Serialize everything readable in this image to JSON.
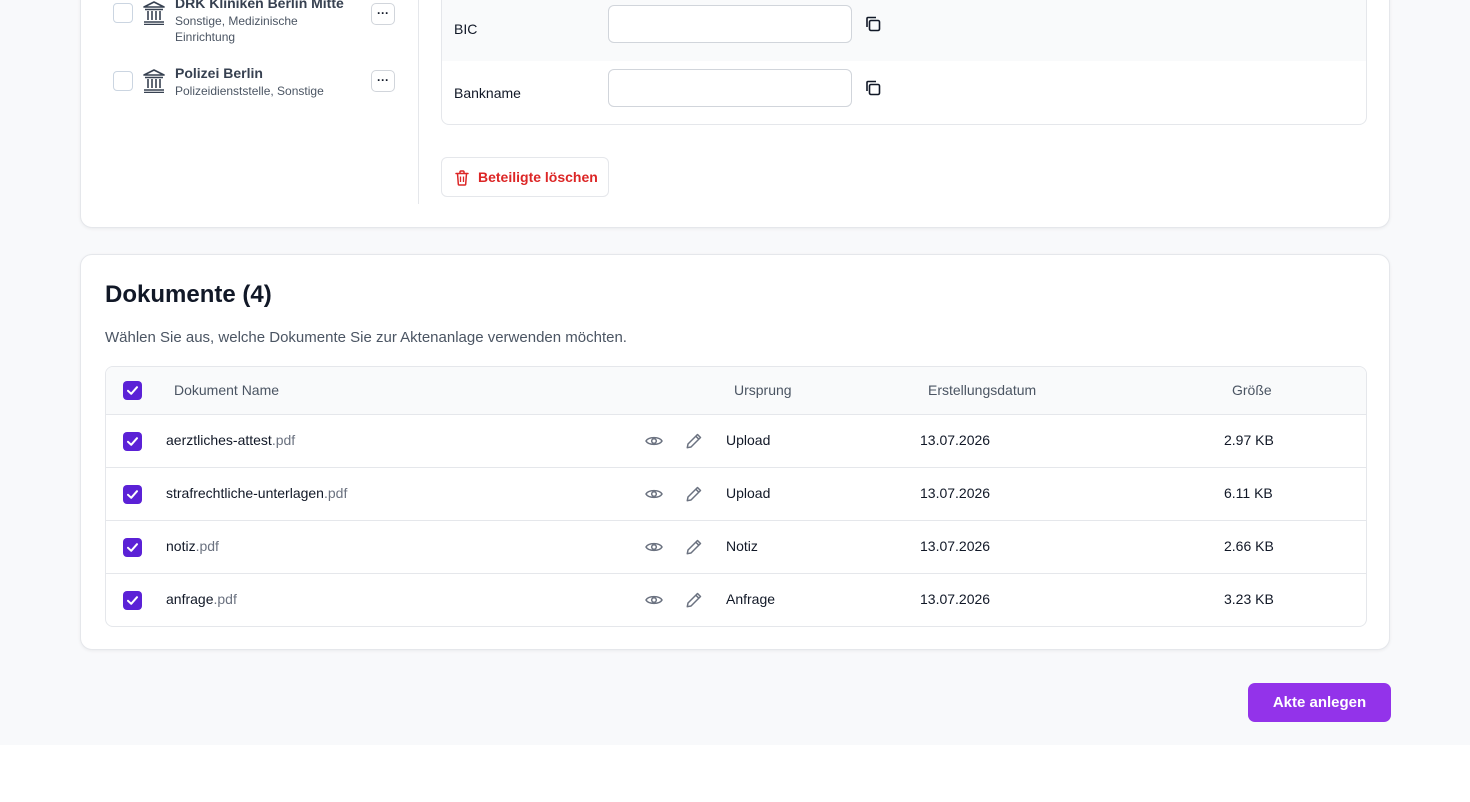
{
  "parties": [
    {
      "name": "DRK Kliniken Berlin Mitte",
      "subtitle": "Sonstige, Medizinische Einrichtung",
      "more_label": "···"
    },
    {
      "name": "Polizei Berlin",
      "subtitle": "Polizeidienststelle, Sonstige",
      "more_label": "···"
    }
  ],
  "bank_fields": {
    "bic": {
      "label": "BIC",
      "value": ""
    },
    "bankname": {
      "label": "Bankname",
      "value": ""
    }
  },
  "delete_button": {
    "label": "Beteiligte löschen"
  },
  "documents": {
    "title": "Dokumente (4)",
    "subtitle": "Wählen Sie aus, welche Dokumente Sie zur Aktenanlage verwenden möchten.",
    "columns": {
      "name": "Dokument Name",
      "origin": "Ursprung",
      "date": "Erstellungsdatum",
      "size": "Größe"
    },
    "rows": [
      {
        "name": "aerztliches-attest",
        "ext": ".pdf",
        "origin": "Upload",
        "date": "13.07.2026",
        "size": "2.97 KB"
      },
      {
        "name": "strafrechtliche-unterlagen",
        "ext": ".pdf",
        "origin": "Upload",
        "date": "13.07.2026",
        "size": "6.11 KB"
      },
      {
        "name": "notiz",
        "ext": ".pdf",
        "origin": "Notiz",
        "date": "13.07.2026",
        "size": "2.66 KB"
      },
      {
        "name": "anfrage",
        "ext": ".pdf",
        "origin": "Anfrage",
        "date": "13.07.2026",
        "size": "3.23 KB"
      }
    ]
  },
  "create_button": {
    "label": "Akte anlegen"
  },
  "colors": {
    "accent": "#9333ea",
    "checkbox": "#5b21d6",
    "danger": "#dc2626"
  },
  "icons": [
    "institution-icon",
    "copy-icon",
    "trash-icon",
    "eye-icon",
    "pencil-icon",
    "check-icon"
  ]
}
